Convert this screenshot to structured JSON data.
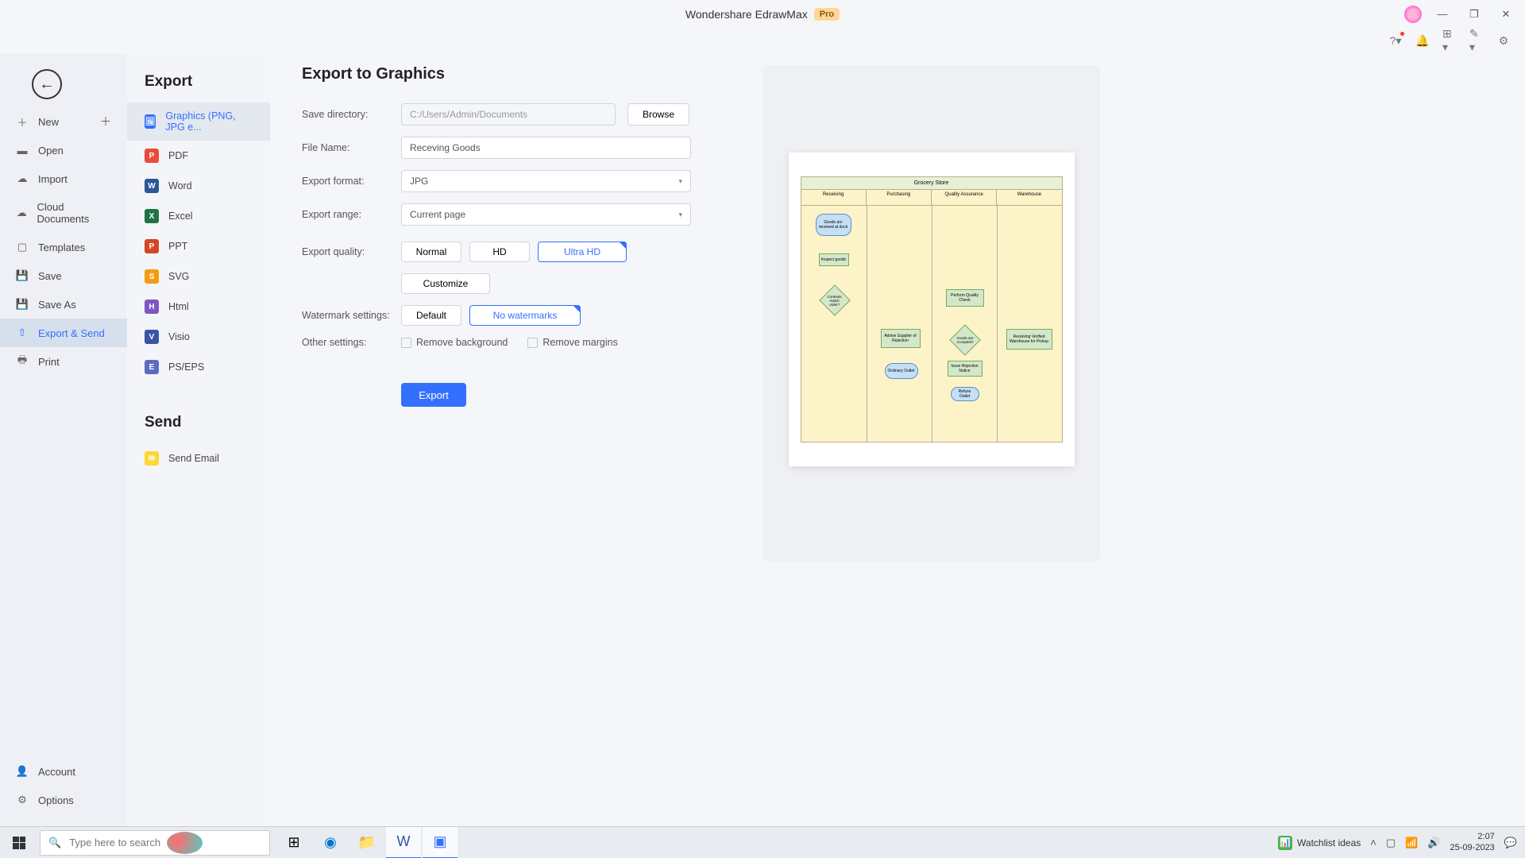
{
  "app": {
    "title": "Wondershare EdrawMax",
    "badge": "Pro"
  },
  "window": {
    "minimize": "—",
    "maximize": "❐",
    "close": "✕"
  },
  "backarrow": "←",
  "sidebar_file": {
    "items": [
      {
        "label": "New",
        "icon": "＋"
      },
      {
        "label": "Open",
        "icon": "▬"
      },
      {
        "label": "Import",
        "icon": "☁"
      },
      {
        "label": "Cloud Documents",
        "icon": "☁"
      },
      {
        "label": "Templates",
        "icon": "▢"
      },
      {
        "label": "Save",
        "icon": "💾"
      },
      {
        "label": "Save As",
        "icon": "💾"
      },
      {
        "label": "Export & Send",
        "icon": "⇧"
      },
      {
        "label": "Print",
        "icon": "🖶"
      }
    ],
    "bottom": [
      {
        "label": "Account",
        "icon": "👤"
      },
      {
        "label": "Options",
        "icon": "⚙"
      }
    ],
    "plus": "＋"
  },
  "export_sidebar": {
    "title_export": "Export",
    "title_send": "Send",
    "items": [
      {
        "label": "Graphics (PNG, JPG e...",
        "ic": "🖼"
      },
      {
        "label": "PDF",
        "ic": "P"
      },
      {
        "label": "Word",
        "ic": "W"
      },
      {
        "label": "Excel",
        "ic": "X"
      },
      {
        "label": "PPT",
        "ic": "P"
      },
      {
        "label": "SVG",
        "ic": "S"
      },
      {
        "label": "Html",
        "ic": "H"
      },
      {
        "label": "Visio",
        "ic": "V"
      },
      {
        "label": "PS/EPS",
        "ic": "E"
      }
    ],
    "send_items": [
      {
        "label": "Send Email",
        "ic": "✉"
      }
    ]
  },
  "form": {
    "title": "Export to Graphics",
    "save_dir_label": "Save directory:",
    "save_dir_value": "C:/Users/Admin/Documents",
    "browse": "Browse",
    "filename_label": "File Name:",
    "filename_value": "Receving Goods",
    "format_label": "Export format:",
    "format_value": "JPG",
    "range_label": "Export range:",
    "range_value": "Current page",
    "quality_label": "Export quality:",
    "quality": [
      "Normal",
      "HD",
      "Ultra HD"
    ],
    "customize": "Customize",
    "watermark_label": "Watermark settings:",
    "watermark": [
      "Default",
      "No watermarks"
    ],
    "other_label": "Other settings:",
    "remove_bg": "Remove background",
    "remove_margins": "Remove margins",
    "export_btn": "Export",
    "dropdown_arrow": "▾"
  },
  "preview": {
    "title": "Grocery Store",
    "lanes": [
      "Receiving",
      "Purchasing",
      "Quality Assurance",
      "Warehouse"
    ],
    "shapes": {
      "goods_received": "Goods are received at dock",
      "inspect": "Inspect goods",
      "match": "Contents match order?",
      "advise": "Advise Supplier of Rejection",
      "dailyout": "Ordinary Outlet",
      "quality": "Perform Quality Check",
      "accepted": "Goods are Accepted?",
      "notice": "Issue Rejection Notice",
      "refuse": "Refuse Outlet",
      "warehouse": "Receiving Verified Warehouse for Pickup"
    }
  },
  "taskbar": {
    "search_placeholder": "Type here to search",
    "watchlist": "Watchlist ideas",
    "time": "2:07",
    "date": "25-09-2023"
  }
}
